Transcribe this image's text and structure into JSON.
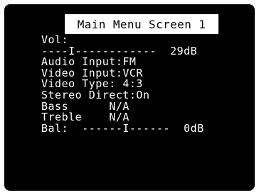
{
  "menu": {
    "title": "Main Menu Screen 1",
    "volume_label": "Vol:",
    "volume_bar": "----I------------",
    "volume_value": "29dB",
    "audio_input": "Audio Input:FM",
    "video_input": "Video Input:VCR",
    "video_type": "Video Type: 4:3",
    "stereo_direct": "Stereo Direct:On",
    "bass_label": "Bass",
    "bass_value": "N/A",
    "treble_label": "Treble",
    "treble_value": "N/A",
    "balance_label": "Bal:",
    "balance_bar": "------I------",
    "balance_value": "0dB"
  },
  "colors": {
    "screen_background": "#000000",
    "text": "#ffffff",
    "title_background": "#ffffff",
    "title_text": "#000000"
  }
}
